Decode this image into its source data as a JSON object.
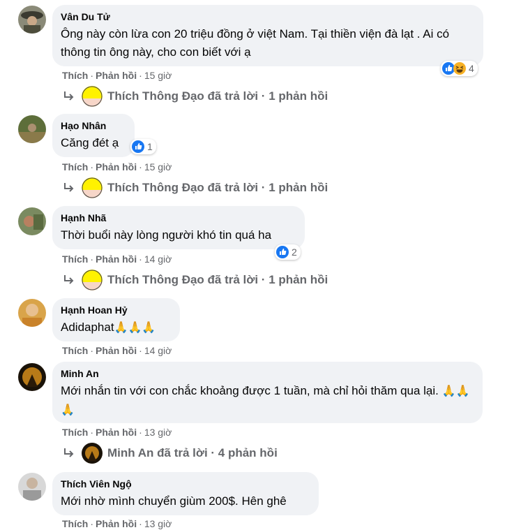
{
  "labels": {
    "like": "Thích",
    "reply": "Phản hồi",
    "dot": "·"
  },
  "comments": [
    {
      "author": "Vân Du Tử",
      "text": "Ông này còn lừa con 20 triệu đồng ở việt Nam. Tại thiền viện đà lạt . Ai có thông tin ông này, cho con biết với ạ",
      "time": "15 giờ",
      "reactions": {
        "icons": [
          "like-icon",
          "haha-icon"
        ],
        "count": "4"
      },
      "reply_link": "Thích Thông Đạo đã trả lời · 1 phản hồi"
    },
    {
      "author": "Hạo Nhân",
      "text": "Căng đét ạ",
      "time": "15 giờ",
      "reactions": {
        "icons": [
          "like-icon"
        ],
        "count": "1"
      },
      "reply_link": "Thích Thông Đạo đã trả lời · 1 phản hồi"
    },
    {
      "author": "Hạnh Nhã",
      "text": "Thời buổi này lòng người khó tin quá ha",
      "time": "14 giờ",
      "reactions": {
        "icons": [
          "like-icon"
        ],
        "count": "2"
      },
      "reply_link": "Thích Thông Đạo đã trả lời · 1 phản hồi"
    },
    {
      "author": "Hạnh Hoan Hỷ",
      "text": "Adidaphat",
      "emoji": "🙏🙏🙏",
      "time": "14 giờ"
    },
    {
      "author": "Minh An",
      "text": "Mới nhắn tin với con chắc khoảng được 1 tuần, mà chỉ hỏi thăm qua lại.",
      "emoji": "🙏🙏🙏",
      "time": "13 giờ",
      "reply_link": "Minh An đã trả lời · 4 phản hồi"
    },
    {
      "author": "Thích Viên Ngộ",
      "text": "Mới nhờ mình chuyển giùm 200$. Hên ghê",
      "time": "13 giờ"
    }
  ],
  "colors": {
    "bubble": "#f0f2f5",
    "meta": "#65676b",
    "like_blue": "#1877f2",
    "haha_yellow": "#f7b125"
  }
}
